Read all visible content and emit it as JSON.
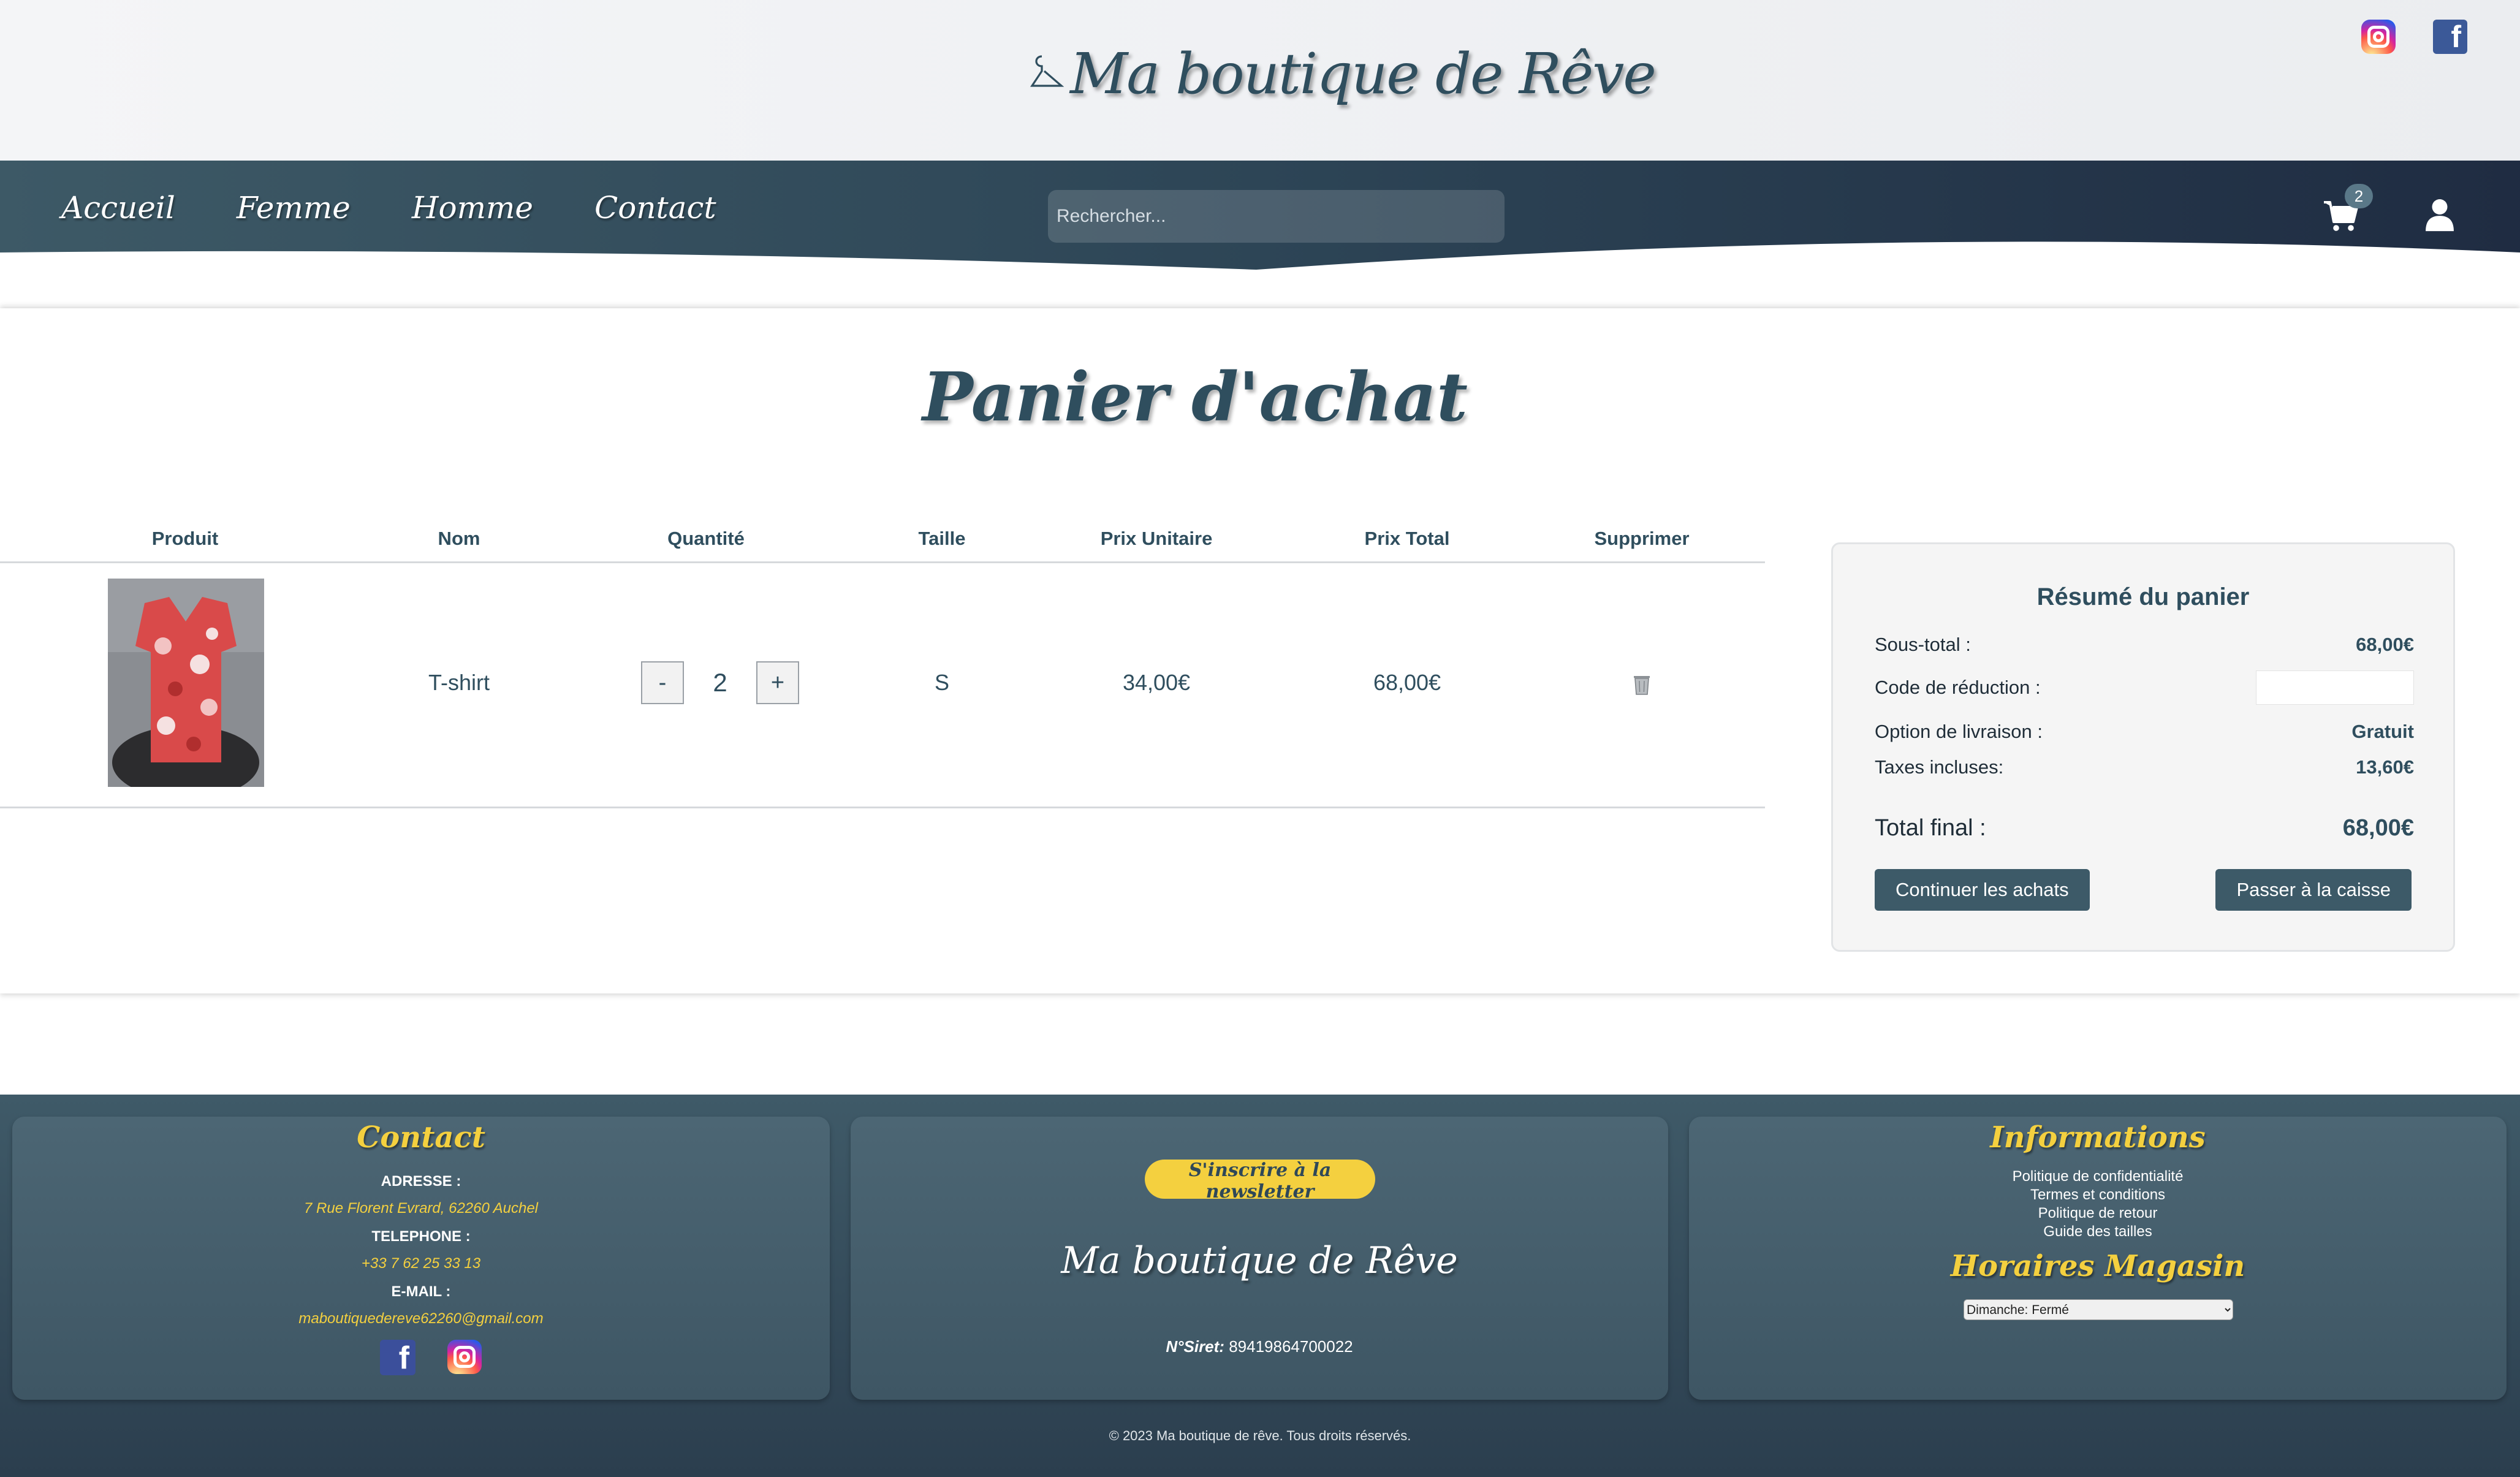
{
  "header": {
    "logo_text": "Ma boutique de Rêve"
  },
  "nav": {
    "links": [
      "Accueil",
      "Femme",
      "Homme",
      "Contact"
    ],
    "search_placeholder": "Rechercher...",
    "cart_count": "2"
  },
  "page": {
    "title": "Panier d'achat"
  },
  "table": {
    "headers": [
      "Produit",
      "Nom",
      "Quantité",
      "Taille",
      "Prix Unitaire",
      "Prix Total",
      "Supprimer"
    ],
    "rows": [
      {
        "name": "T-shirt",
        "quantity": "2",
        "decrement": "-",
        "increment": "+",
        "size": "S",
        "unit_price": "34,00€",
        "total_price": "68,00€"
      }
    ]
  },
  "summary": {
    "title": "Résumé du panier",
    "subtotal_label": "Sous-total :",
    "subtotal_value": "68,00€",
    "promo_label": "Code de réduction :",
    "promo_value": "",
    "shipping_label": "Option de livraison :",
    "shipping_value": "Gratuit",
    "tax_label": "Taxes incluses:",
    "tax_value": "13,60€",
    "total_label": "Total final :",
    "total_value": "68,00€",
    "continue_button": "Continuer les achats",
    "checkout_button": "Passer à la caisse"
  },
  "footer": {
    "contact": {
      "heading": "Contact",
      "address_label": "ADRESSE :",
      "address": "7 Rue Florent Evrard, 62260 Auchel",
      "phone_label": "TELEPHONE :",
      "phone": "+33 7 62 25 33 13",
      "email_label": "E-MAIL :",
      "email": "maboutiquedereve62260@gmail.com"
    },
    "newsletter": {
      "button": "S'inscrire à la newsletter",
      "logo_text": "Ma boutique de Rêve",
      "siret_label": "N°Siret:",
      "siret_value": "89419864700022"
    },
    "info": {
      "heading": "Informations",
      "links": [
        "Politique de confidentialité",
        "Termes et conditions",
        "Politique de retour",
        "Guide des tailles"
      ],
      "hours_heading": "Horaires Magasin",
      "hours_selected": "Dimanche: Fermé"
    },
    "copyright": "© 2023 Ma boutique de rêve. Tous droits réservés."
  },
  "colors": {
    "primary": "#2f4e5e",
    "nav_bg_start": "#3d5966",
    "nav_bg_end": "#1f2c42",
    "accent_yellow": "#f4d03f",
    "button_bg": "#3d5a68"
  }
}
